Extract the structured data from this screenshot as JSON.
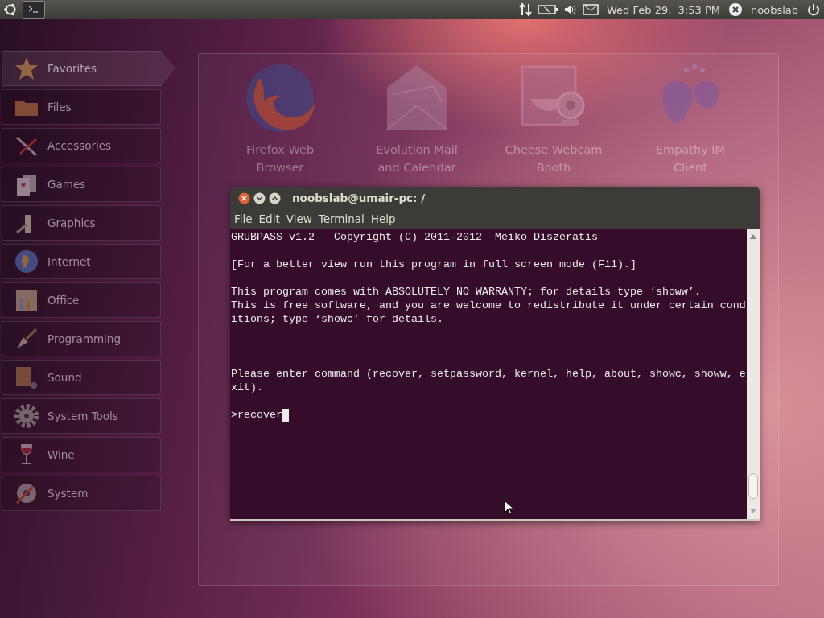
{
  "top_panel": {
    "clock": "Wed Feb 29,  3:53 PM",
    "user": "noobslab"
  },
  "sidebar": {
    "items": [
      {
        "label": "Favorites",
        "selected": true
      },
      {
        "label": "Files",
        "selected": false
      },
      {
        "label": "Accessories",
        "selected": false
      },
      {
        "label": "Games",
        "selected": false
      },
      {
        "label": "Graphics",
        "selected": false
      },
      {
        "label": "Internet",
        "selected": false
      },
      {
        "label": "Office",
        "selected": false
      },
      {
        "label": "Programming",
        "selected": false
      },
      {
        "label": "Sound",
        "selected": false
      },
      {
        "label": "System Tools",
        "selected": false
      },
      {
        "label": "Wine",
        "selected": false
      },
      {
        "label": "System",
        "selected": false
      }
    ]
  },
  "favorites": [
    {
      "label": "Firefox Web\nBrowser"
    },
    {
      "label": "Evolution Mail\nand Calendar"
    },
    {
      "label": "Cheese Webcam\nBooth"
    },
    {
      "label": "Empathy IM\nClient"
    }
  ],
  "terminal": {
    "title": "noobslab@umair-pc: /",
    "menu": [
      "File",
      "Edit",
      "View",
      "Terminal",
      "Help"
    ],
    "output": "GRUBPASS v1.2   Copyright (C) 2011-2012  Meiko Diszeratis\n\n[For a better view run this program in full screen mode (F11).]\n\nThis program comes with ABSOLUTELY NO WARRANTY; for details type ‘showw’.\nThis is free software, and you are welcome to redistribute it under certain cond\nitions; type ‘showc’ for details.\n\n\n\nPlease enter command (recover, setpassword, kernel, help, about, showc, showw, e\nxit).",
    "prompt": ">recover"
  }
}
